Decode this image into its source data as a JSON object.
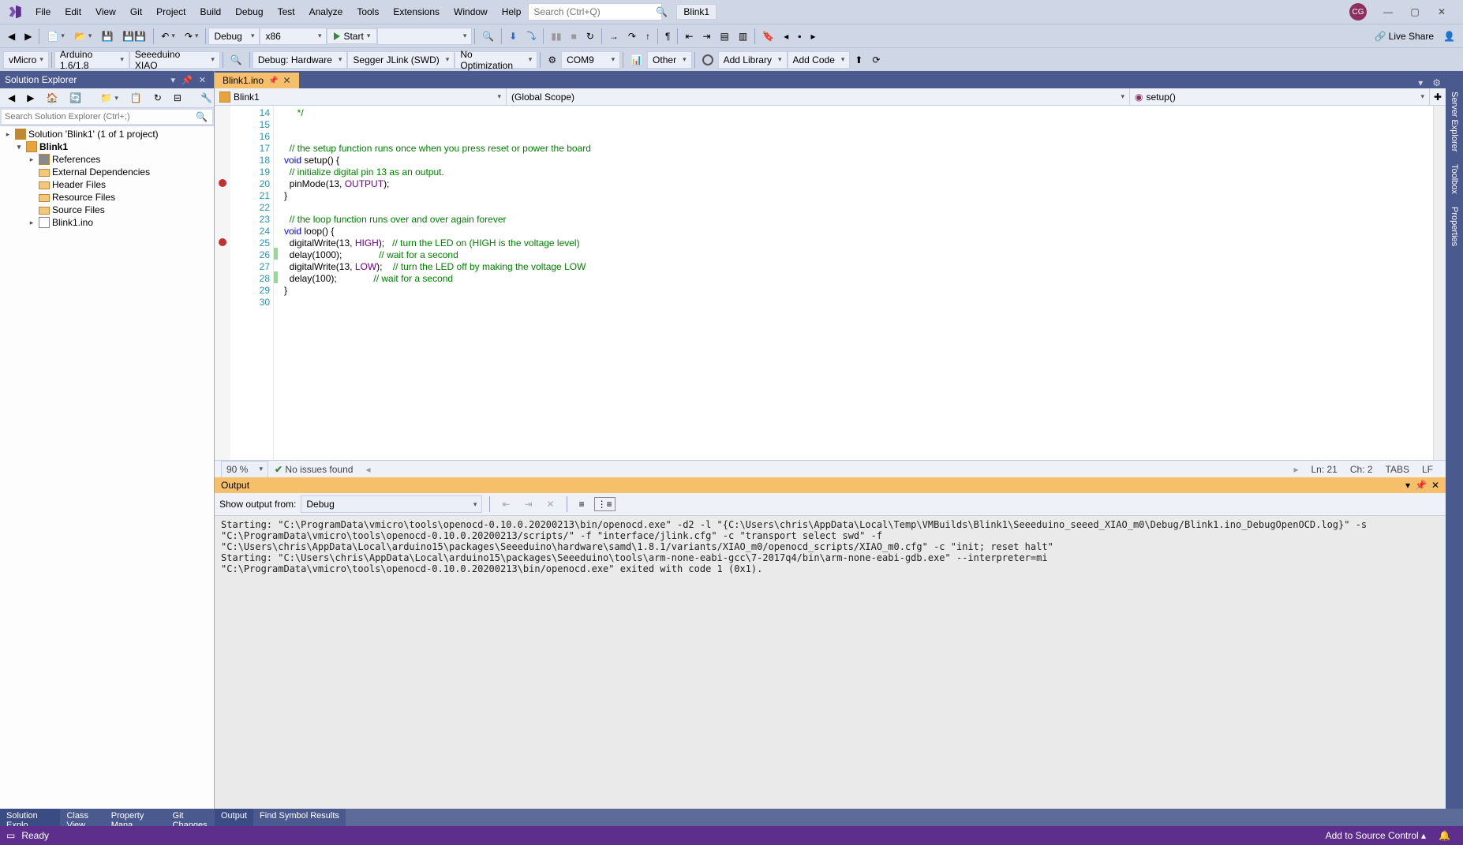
{
  "menu": [
    "File",
    "Edit",
    "View",
    "Git",
    "Project",
    "Build",
    "Debug",
    "Test",
    "Analyze",
    "Tools",
    "Extensions",
    "Window",
    "Help"
  ],
  "search_placeholder": "Search (Ctrl+Q)",
  "app_title": "Blink1",
  "avatar": "CG",
  "live_share": "Live Share",
  "toolbar1": {
    "config": "Debug",
    "platform": "x86",
    "start": "Start"
  },
  "toolbar2": {
    "vmicro": "vMicro",
    "arduino_ver": "Arduino 1.6/1.8",
    "board": "Seeeduino XIAO",
    "debug_mode": "Debug: Hardware",
    "debugger": "Segger JLink (SWD)",
    "optimization": "No Optimization",
    "port": "COM9",
    "other": "Other",
    "add_library": "Add Library",
    "add_code": "Add Code"
  },
  "solution_panel": {
    "title": "Solution Explorer",
    "search_placeholder": "Search Solution Explorer (Ctrl+;)",
    "root": "Solution 'Blink1' (1 of 1 project)",
    "project": "Blink1",
    "nodes": [
      "References",
      "External Dependencies",
      "Header Files",
      "Resource Files",
      "Source Files",
      "Blink1.ino"
    ]
  },
  "editor": {
    "tab": "Blink1.ino",
    "nav_left": "Blink1",
    "nav_mid": "(Global Scope)",
    "nav_right": "setup()",
    "lines": [
      {
        "n": 14,
        "html": "     <span class='c-com'>*/</span>"
      },
      {
        "n": 15,
        "html": ""
      },
      {
        "n": 16,
        "html": ""
      },
      {
        "n": 17,
        "html": "  <span class='c-com'>// the setup function runs once when you press reset or power the board</span>"
      },
      {
        "n": 18,
        "html": "<span class='c-kw'>void</span> setup() {"
      },
      {
        "n": 19,
        "html": "  <span class='c-com'>// initialize digital pin 13 as an output.</span>"
      },
      {
        "n": 20,
        "html": "  pinMode(13, <span class='c-const'>OUTPUT</span>);",
        "bp": true
      },
      {
        "n": 21,
        "html": "}"
      },
      {
        "n": 22,
        "html": ""
      },
      {
        "n": 23,
        "html": "  <span class='c-com'>// the loop function runs over and over again forever</span>"
      },
      {
        "n": 24,
        "html": "<span class='c-kw'>void</span> loop() {"
      },
      {
        "n": 25,
        "html": "  digitalWrite(13, <span class='c-const'>HIGH</span>);   <span class='c-com'>// turn the LED on (HIGH is the voltage level)</span>",
        "bp": true
      },
      {
        "n": 26,
        "html": "  delay(1000);              <span class='c-com'>// wait for a second</span>",
        "mark": true
      },
      {
        "n": 27,
        "html": "  digitalWrite(13, <span class='c-const'>LOW</span>);    <span class='c-com'>// turn the LED off by making the voltage LOW</span>"
      },
      {
        "n": 28,
        "html": "  delay(100);              <span class='c-com'>// wait for a second</span>",
        "mark": true
      },
      {
        "n": 29,
        "html": "}"
      },
      {
        "n": 30,
        "html": ""
      }
    ],
    "zoom": "90 %",
    "issues": "No issues found",
    "pos_ln": "Ln: 21",
    "pos_ch": "Ch: 2",
    "tabs_ind": "TABS",
    "lf": "LF"
  },
  "output": {
    "title": "Output",
    "show_label": "Show output from:",
    "source": "Debug",
    "text": "Starting: \"C:\\ProgramData\\vmicro\\tools\\openocd-0.10.0.20200213\\bin/openocd.exe\" -d2 -l \"{C:\\Users\\chris\\AppData\\Local\\Temp\\VMBuilds\\Blink1\\Seeeduino_seeed_XIAO_m0\\Debug/Blink1.ino_DebugOpenOCD.log}\" -s \"C:\\ProgramData\\vmicro\\tools\\openocd-0.10.0.20200213/scripts/\" -f \"interface/jlink.cfg\" -c \"transport select swd\" -f \"C:\\Users\\chris\\AppData\\Local\\arduino15\\packages\\Seeeduino\\hardware\\samd\\1.8.1/variants/XIAO_m0/openocd_scripts/XIAO_m0.cfg\" -c \"init; reset halt\"\nStarting: \"C:\\Users\\chris\\AppData\\Local\\arduino15\\packages\\Seeeduino\\tools\\arm-none-eabi-gcc\\7-2017q4/bin\\arm-none-eabi-gdb.exe\" --interpreter=mi\n\"C:\\ProgramData\\vmicro\\tools\\openocd-0.10.0.20200213\\bin/openocd.exe\" exited with code 1 (0x1).\n"
  },
  "bottom_tabs_left": [
    "Solution Explo…",
    "Class View",
    "Property Mana…",
    "Git Changes"
  ],
  "bottom_tabs_right": [
    "Output",
    "Find Symbol Results"
  ],
  "right_rail": [
    "Server Explorer",
    "Toolbox",
    "Properties"
  ],
  "statusbar": {
    "ready": "Ready",
    "source_control": "Add to Source Control"
  }
}
